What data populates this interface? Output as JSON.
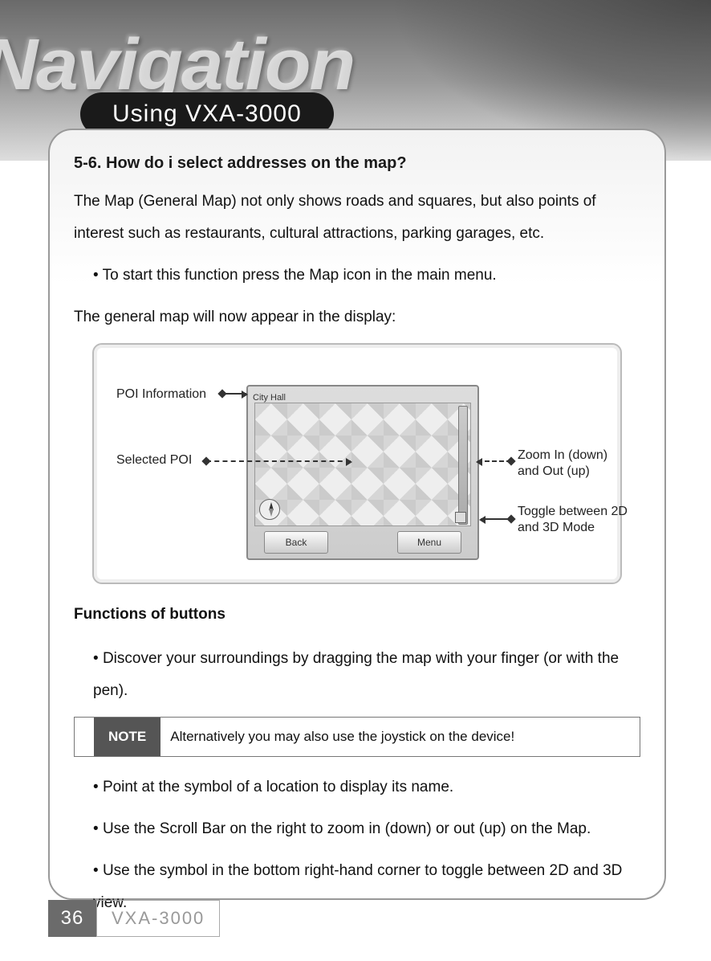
{
  "header": {
    "stylized_word": "Navigation",
    "section_title": "Using VXA-3000"
  },
  "content": {
    "heading": "5-6. How do i select  addresses on the map?",
    "intro": "The Map (General Map) not only shows roads and squares, but also points of interest such as restaurants, cultural attractions, parking garages, etc.",
    "start_bullet": "To start this function press the Map icon in the main menu.",
    "appear_line": "The general map will now appear in the display:",
    "diagram": {
      "map_title": "City Hall",
      "watermark": "",
      "back_btn": "Back",
      "menu_btn": "Menu",
      "callouts": {
        "poi_info": "POI Information",
        "selected_poi": "Selected POI",
        "zoom": "Zoom In (down) and Out (up)",
        "toggle": "Toggle between 2D and 3D Mode"
      }
    },
    "functions_heading": "Functions of buttons",
    "bullets": [
      "Discover your surroundings by dragging the map with your finger (or with the pen).",
      "Point at the symbol of a location to display its name.",
      "Use the Scroll Bar on the right to zoom in (down) or out (up) on the Map.",
      "Use the symbol in the bottom right-hand corner to toggle between 2D and 3D view."
    ],
    "note": {
      "label": "NOTE",
      "text": "Alternatively you may also use the joystick on the device!"
    }
  },
  "footer": {
    "page_number": "36",
    "model": "VXA-3000"
  }
}
